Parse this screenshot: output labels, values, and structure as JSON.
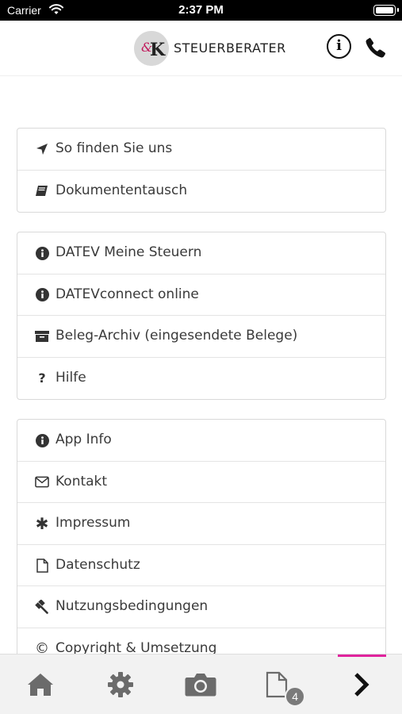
{
  "status_bar": {
    "carrier": "Carrier",
    "time": "2:37 PM"
  },
  "header": {
    "brand": "STEUERBERATER",
    "logo_text": "&K",
    "info_icon": "info-circle-icon",
    "phone_icon": "phone-icon"
  },
  "menu": {
    "group1": [
      {
        "label": "So finden Sie uns",
        "icon": "location-arrow-icon"
      },
      {
        "label": "Dokumententausch",
        "icon": "book-icon"
      }
    ],
    "group2": [
      {
        "label": "DATEV Meine Steuern",
        "icon": "info-circle-icon"
      },
      {
        "label": "DATEVconnect online",
        "icon": "info-circle-icon"
      },
      {
        "label": "Beleg-Archiv (eingesendete Belege)",
        "icon": "archive-icon"
      },
      {
        "label": "Hilfe",
        "icon": "question-icon"
      }
    ],
    "group3": [
      {
        "label": "App Info",
        "icon": "info-circle-icon"
      },
      {
        "label": "Kontakt",
        "icon": "envelope-icon"
      },
      {
        "label": "Impressum",
        "icon": "asterisk-icon"
      },
      {
        "label": "Datenschutz",
        "icon": "document-icon"
      },
      {
        "label": "Nutzungsbedingungen",
        "icon": "gavel-icon"
      },
      {
        "label": "Copyright & Umsetzung",
        "icon": "copyright-icon"
      }
    ]
  },
  "tab_bar": {
    "tabs": [
      {
        "icon": "home-icon"
      },
      {
        "icon": "gear-icon"
      },
      {
        "icon": "camera-icon"
      },
      {
        "icon": "document-icon",
        "badge": "4"
      },
      {
        "icon": "chevron-right-icon",
        "active": true
      }
    ],
    "accent": "#e0239d"
  }
}
